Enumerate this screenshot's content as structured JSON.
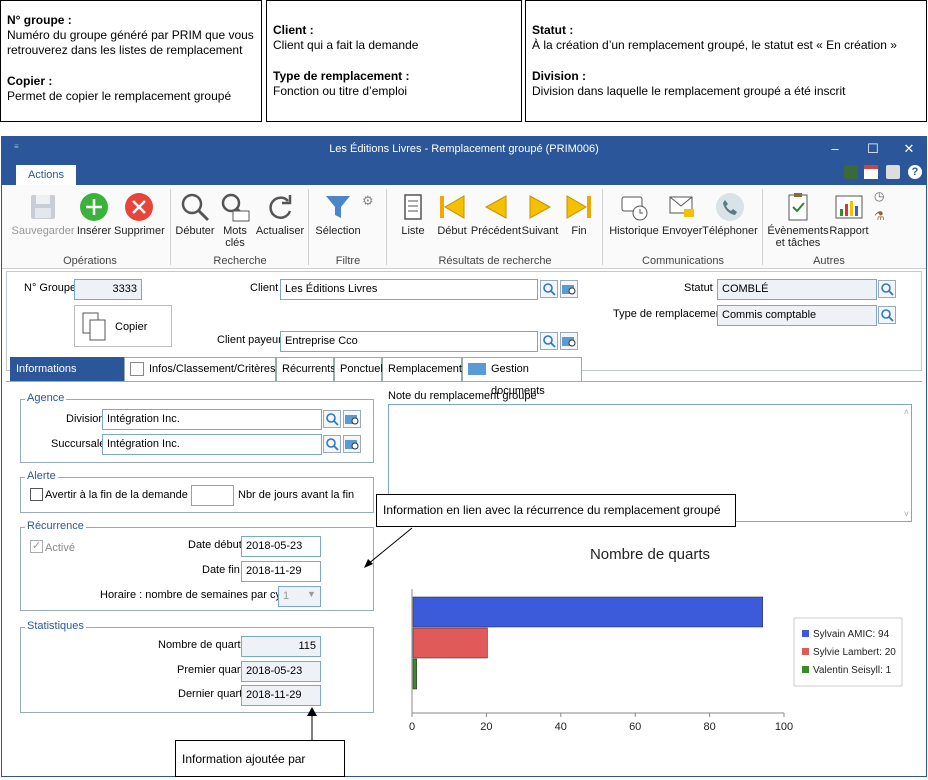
{
  "notes": [
    {
      "title": "N° groupe :",
      "text": "Numéro du groupe généré par PRIM que vous retrouverez dans les listes de remplacement",
      "title2": "Copier :",
      "text2": "Permet de copier le remplacement groupé"
    },
    {
      "title": "Client :",
      "text": "Client qui a fait la demande",
      "title2": "Type de remplacement :",
      "text2": "Fonction ou titre d’emploi"
    },
    {
      "title": "Statut :",
      "text": "À la création d’un remplacement groupé, le statut est « En création »",
      "title2": "Division :",
      "text2": "Division dans laquelle le remplacement groupé a été inscrit"
    }
  ],
  "window": {
    "title": "Les Éditions Livres - Remplacement groupé (PRIM006)",
    "tab": "Actions",
    "minimize": "–",
    "maximize": "☐",
    "close": "✕"
  },
  "ribbon": {
    "buttons": [
      {
        "label": "Sauvegarder",
        "icon": "save-icon"
      },
      {
        "label": "Insérer",
        "icon": "add-icon"
      },
      {
        "label": "Supprimer",
        "icon": "delete-icon"
      },
      {
        "label": "Débuter",
        "icon": "search-icon"
      },
      {
        "label": "Mots\nclés",
        "icon": "keyword-search-icon"
      },
      {
        "label": "Actualiser",
        "icon": "refresh-icon"
      },
      {
        "label": "Sélection",
        "icon": "filter-icon"
      },
      {
        "label": "Liste",
        "icon": "list-icon"
      },
      {
        "label": "Début",
        "icon": "first-icon"
      },
      {
        "label": "Précédent",
        "icon": "previous-icon"
      },
      {
        "label": "Suivant",
        "icon": "next-icon"
      },
      {
        "label": "Fin",
        "icon": "last-icon"
      },
      {
        "label": "Historique",
        "icon": "history-icon"
      },
      {
        "label": "Envoyer",
        "icon": "send-icon"
      },
      {
        "label": "Téléphoner",
        "icon": "phone-icon"
      },
      {
        "label": "Évènements\net tâches",
        "icon": "tasks-icon"
      },
      {
        "label": "Rapport",
        "icon": "report-icon"
      }
    ],
    "groups": [
      "Opérations",
      "Recherche",
      "Filtre",
      "Résultats de recherche",
      "Communications",
      "Autres"
    ]
  },
  "form": {
    "groupe_label": "N° Groupe",
    "groupe_value": "3333",
    "copier": "Copier",
    "client_label": "Client",
    "client_value": "Les Éditions Livres",
    "client_payeur_label": "Client payeur",
    "client_payeur_value": "Entreprise Cco",
    "statut_label": "Statut",
    "statut_value": "COMBLÉ",
    "type_label": "Type de remplacement",
    "type_value": "Commis comptable"
  },
  "tabs": [
    "Informations générales",
    "Infos/Classement/Critères",
    "Récurrents",
    "Ponctuel",
    "Remplacements",
    "Gestion documents"
  ],
  "agence": {
    "legend": "Agence",
    "division_label": "Division",
    "division_value": "Intégration Inc.",
    "succursale_label": "Succursale",
    "succursale_value": "Intégration Inc."
  },
  "alerte": {
    "legend": "Alerte",
    "avertir_label": "Avertir à la fin de la demande",
    "jours_label": "Nbr de jours avant la fin",
    "jours_value": ""
  },
  "recurrence": {
    "legend": "Récurrence",
    "active_label": "Activé",
    "date_debut_label": "Date début",
    "date_debut_value": "2018-05-23",
    "date_fin_label": "Date fin",
    "date_fin_value": "2018-11-29",
    "horaire_label": "Horaire : nombre de semaines par cycle",
    "horaire_value": "1"
  },
  "stats": {
    "legend": "Statistiques",
    "quarts_label": "Nombre de quarts",
    "quarts_value": "115",
    "premier_label": "Premier quart",
    "premier_value": "2018-05-23",
    "dernier_label": "Dernier quart",
    "dernier_value": "2018-11-29"
  },
  "note_label": "Note du remplacement groupé",
  "callouts": {
    "recurrence": "Information en lien avec la récurrence du remplacement groupé",
    "prim": "Information ajoutée par PRIM"
  },
  "chart_data": {
    "type": "bar",
    "orientation": "horizontal",
    "title": "Nombre de quarts",
    "categories": [
      "Sylvain AMIC",
      "Sylvie Lambert",
      "Valentin Seisyll"
    ],
    "values": [
      94,
      20,
      1
    ],
    "colors": [
      "#3b5bdb",
      "#e05a5a",
      "#3a8a2a"
    ],
    "legend_labels": [
      "Sylvain AMIC: 94",
      "Sylvie Lambert: 20",
      "Valentin Seisyll: 1"
    ],
    "xlim": [
      0,
      100
    ],
    "xticks": [
      "0",
      "20",
      "40",
      "60",
      "80",
      "100"
    ],
    "legend": "right"
  }
}
